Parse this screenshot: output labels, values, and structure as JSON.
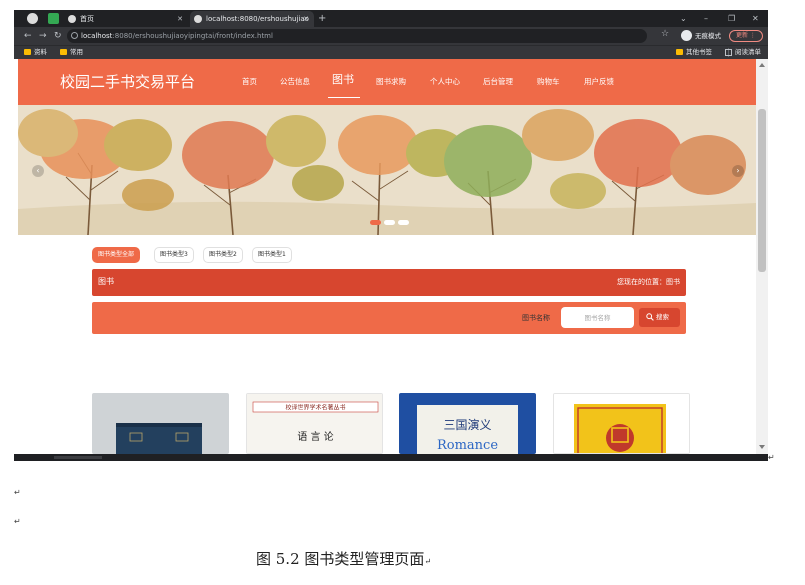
{
  "browser": {
    "tabs": [
      {
        "label": "首页"
      },
      {
        "label": "localhost:8080/ershoushujiao"
      }
    ],
    "window_controls": [
      "⌄",
      "–",
      "❐",
      "✕"
    ],
    "url_host": "localhost",
    "url_rest": ":8080/ershoushujiaoyipingtai/front/index.html",
    "incognito_label": "无痕模式",
    "update_label": "更新",
    "bookmarks_left": [
      "资料",
      "常用"
    ],
    "bookmarks_right": [
      "其他书签",
      "阅读清单"
    ]
  },
  "site": {
    "title": "校园二手书交易平台",
    "nav": [
      "首页",
      "公告信息",
      "图书",
      "图书求购",
      "个人中心",
      "后台管理",
      "购物车",
      "用户反馈"
    ],
    "nav_active_index": 2,
    "banner_slides": 3,
    "banner_active_slide": 0,
    "type_filters": [
      "图书类型全部",
      "图书类型3",
      "图书类型2",
      "图书类型1"
    ],
    "type_filter_active_index": 0,
    "title_bar": {
      "section": "图书",
      "location_label": "您现在的位置：",
      "location_value": "图书"
    },
    "search": {
      "label": "图书名称",
      "placeholder": "图书名称",
      "button": "搜索"
    },
    "cards": [
      {
        "image": "blue hardcover book"
      },
      {
        "image": "语言论 book cover"
      },
      {
        "image": "三国演义 Romance book cover"
      },
      {
        "image": "yellow 国学 book cover"
      }
    ]
  },
  "colors": {
    "accent": "#ef6a48",
    "accent_dark": "#d7462f",
    "chrome_dark": "#202124",
    "chrome_mid": "#35363a"
  },
  "card_text": {
    "c2_top": "校译世界学术名著丛书",
    "c2_title": "语 言 论",
    "c3_title": "三国演义",
    "c3_sub": "Romance"
  },
  "caption": "图 5.2 图书类型管理页面"
}
